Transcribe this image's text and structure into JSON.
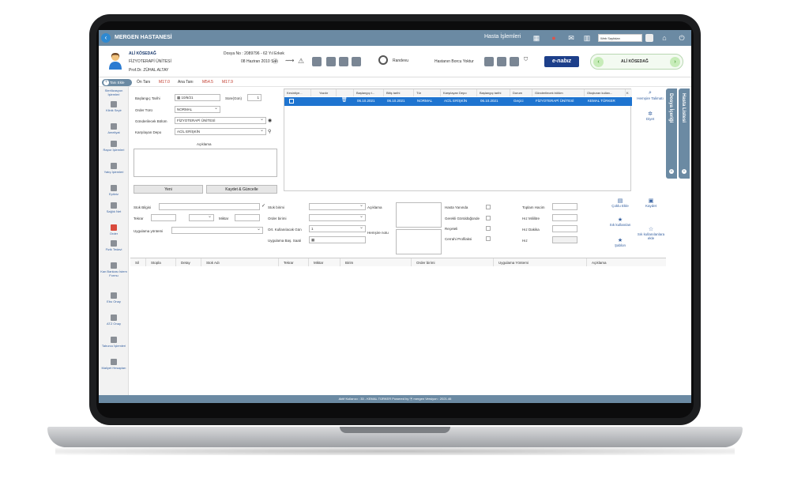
{
  "app": {
    "hospital_name": "MERGEN HASTANESİ",
    "menu_title": "Hasta İşlemleri",
    "workspace_select": "Web Sayfaları"
  },
  "patient": {
    "name": "ALİ KÖSEDAĞ",
    "department": "FİZYOTERAPİ ÜNİTESİ",
    "doctor": "Prof.Dr. ZÜHAL ALTAY",
    "file_info": "Dosya No : 2089796 - 62 Yıl Erkek",
    "birth_date": "08 Haziran 2010 Salı",
    "appointment": "Randevu",
    "debt_status": "Hastanın Borcu Yoktur",
    "nabiz_logo": "e-nabız",
    "nav_name": "ALİ KÖSEDAĞ"
  },
  "diagnosis": {
    "add_label": "Tanı Ekle",
    "on_tani_label": "Ön Tanı",
    "on_tani_code": "M17.0",
    "ana_tani_label": "Ana Tanı",
    "ana_tani_code1": "M54.5",
    "ana_tani_code2": "M17.9"
  },
  "sidebar": {
    "items": [
      {
        "label": "Sterilizasyon İşlemleri"
      },
      {
        "label": "Klinik Seyir"
      },
      {
        "label": "Ameliyat"
      },
      {
        "label": "Rapor İşlemleri"
      },
      {
        "label": "Yatış İşlemleri"
      },
      {
        "label": "Epikriz"
      },
      {
        "label": "Sağlık Net"
      },
      {
        "label": "Order"
      },
      {
        "label": "Fizik Tedavi"
      },
      {
        "label": "Kan Bankası İstem Formu"
      },
      {
        "label": "Ebu Onay"
      },
      {
        "label": "ATZ Onay"
      },
      {
        "label": "Taburcu İşlemleri"
      },
      {
        "label": "Maliyet Hesapları"
      }
    ]
  },
  "order_form": {
    "start_date_label": "Başlangıç Tarihi",
    "start_date_value": "10/6/21",
    "duration_label": "Süre(Gün)",
    "duration_value": "1",
    "order_type_label": "Order Türü",
    "order_type_value": "NORMAL",
    "dept_label": "Gönderilecek Bölüm",
    "dept_value": "FİZYOTERAPİ ÜNİTESİ",
    "depot_label": "Karşılayan Depo",
    "depot_value": "ACİL ERİŞKİN",
    "desc_label": "Açıklama",
    "new_button": "Yeni",
    "save_update_button": "Kaydet & Güncelle"
  },
  "order_grid": {
    "headers": [
      "Kesintiye...",
      "Yazdır",
      "",
      "Başlangıç t...",
      "Bitiş tarihi",
      "Tür",
      "Karşılayan Depo",
      "Başlangıç tarihi",
      "Durum",
      "Gönderilecek bölüm",
      "Oluşturan kullan...",
      "K"
    ],
    "row": {
      "start": "06.10.2021",
      "end": "06.10.2021",
      "type": "NORMAL",
      "depot": "ACİL ERİŞKİN",
      "start2": "06.10.2021",
      "status": "Geçici",
      "dept": "FİZYOTERAPİ ÜNİTESİ",
      "creator": "KEMAL TÜRKER"
    }
  },
  "right_actions": {
    "nurse_instruction": "Hemşire Talimatı",
    "diet": "Diyet",
    "multi_add": "Çoklu Ekle",
    "frequent_used": "Sık kullanılan",
    "template": "Şablon",
    "save": "Kaydet",
    "add_frequent": "Sık kullanılanlara ekle"
  },
  "vertical_tabs": {
    "file_content": "Dosya İçeriği",
    "patient_list": "Hasta Listesi"
  },
  "stock_form": {
    "stock_info_label": "Stok Bilgisi",
    "repeat_label": "Tekrar",
    "amount_label": "Miktar",
    "method_label": "Uygulama yöntemi",
    "stock_unit_label": "Stok birimi",
    "order_unit_label": "Order birimi",
    "usage_days_label": "Ort. Kullanılacak Gün",
    "usage_days_value": "1",
    "apply_time_label": "Uygulama Baş. Saati",
    "desc_label": "Açıklama",
    "nurse_note_label": "Hemşire notu",
    "with_patient_label": "Hasta Yanında",
    "when_needed_label": "Gerekli Görüldüğünde",
    "prescribed_label": "Reçeteli",
    "surgical_prophylaxis_label": "Cerrahi Profilaksi",
    "total_volume_label": "Toplam Hacim",
    "rate_ml_label": "Hız Mililitre",
    "rate_min_label": "Hız Dakika",
    "rate_label": "Hız"
  },
  "stock_grid": {
    "headers": [
      "Sil",
      "Stopla",
      "Detay",
      "Stok Adı",
      "Tekrar",
      "Miktar",
      "Birim",
      "Order birimi",
      "Uygulama Yöntemi",
      "Açıklama"
    ]
  },
  "footer": {
    "text": "Aktif Kullanıcı : 33 - KEMAL TÜRKER    Powered by  ⦿ mergen    Versiyon : 2021.46"
  },
  "colors": {
    "topbar": "#6b8aa3",
    "selected_row": "#1e74d0",
    "diag_code": "#c0392b"
  }
}
